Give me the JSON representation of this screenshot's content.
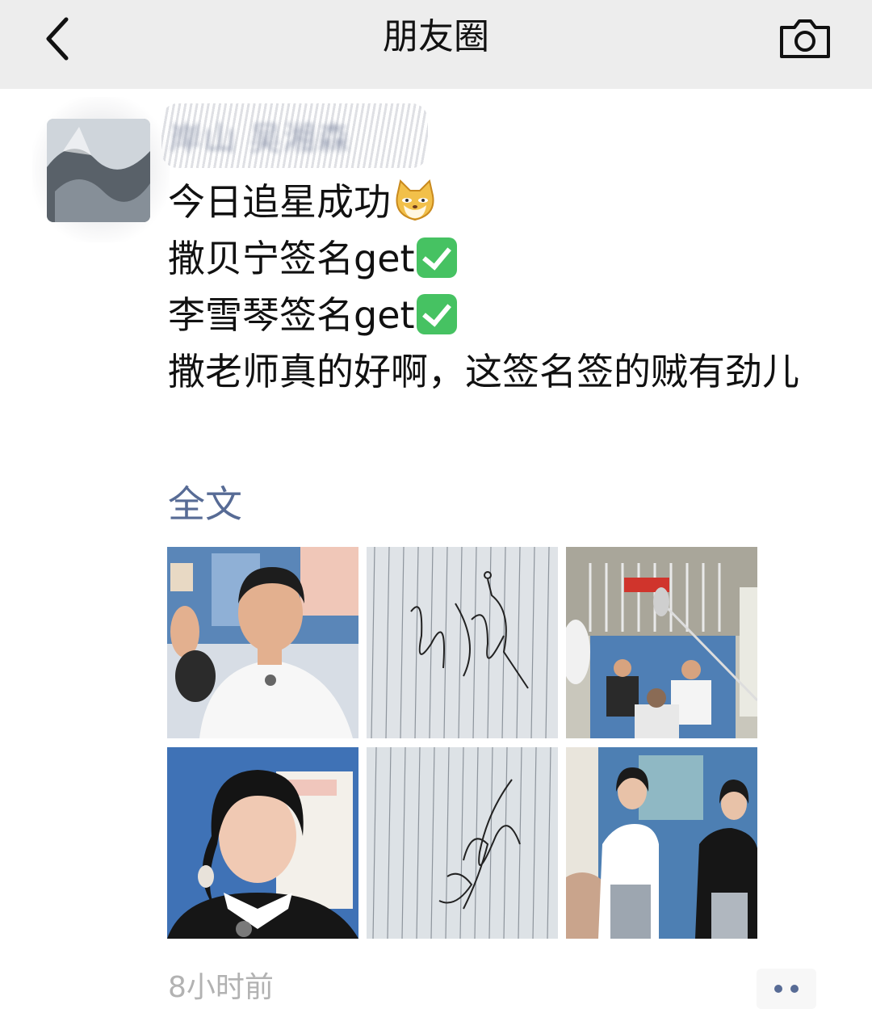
{
  "header": {
    "title": "朋友圈",
    "back_icon": "chevron-left-icon",
    "camera_icon": "camera-icon"
  },
  "post": {
    "author_name": "岸山 吴湘森",
    "lines": [
      {
        "text": "今日追星成功",
        "emoji": "cat-face-emoji"
      },
      {
        "text": "撒贝宁签名get",
        "emoji": "check-mark-button-emoji"
      },
      {
        "text": "李雪琴签名get",
        "emoji": "check-mark-button-emoji"
      },
      {
        "text": "撒老师真的好啊，这签名签的贼有劲儿",
        "emoji": ""
      }
    ],
    "full_text_link": "全文",
    "timestamp": "8小时前",
    "more_icon": "more-dots-icon"
  },
  "photos": [
    {
      "name": "photo-man-waving"
    },
    {
      "name": "photo-signature-1"
    },
    {
      "name": "photo-filming-scene"
    },
    {
      "name": "photo-woman-portrait"
    },
    {
      "name": "photo-signature-2"
    },
    {
      "name": "photo-people-outside"
    }
  ],
  "colors": {
    "link": "#576b95",
    "header_bg": "#ededed",
    "timestamp": "#b2b2b2"
  }
}
